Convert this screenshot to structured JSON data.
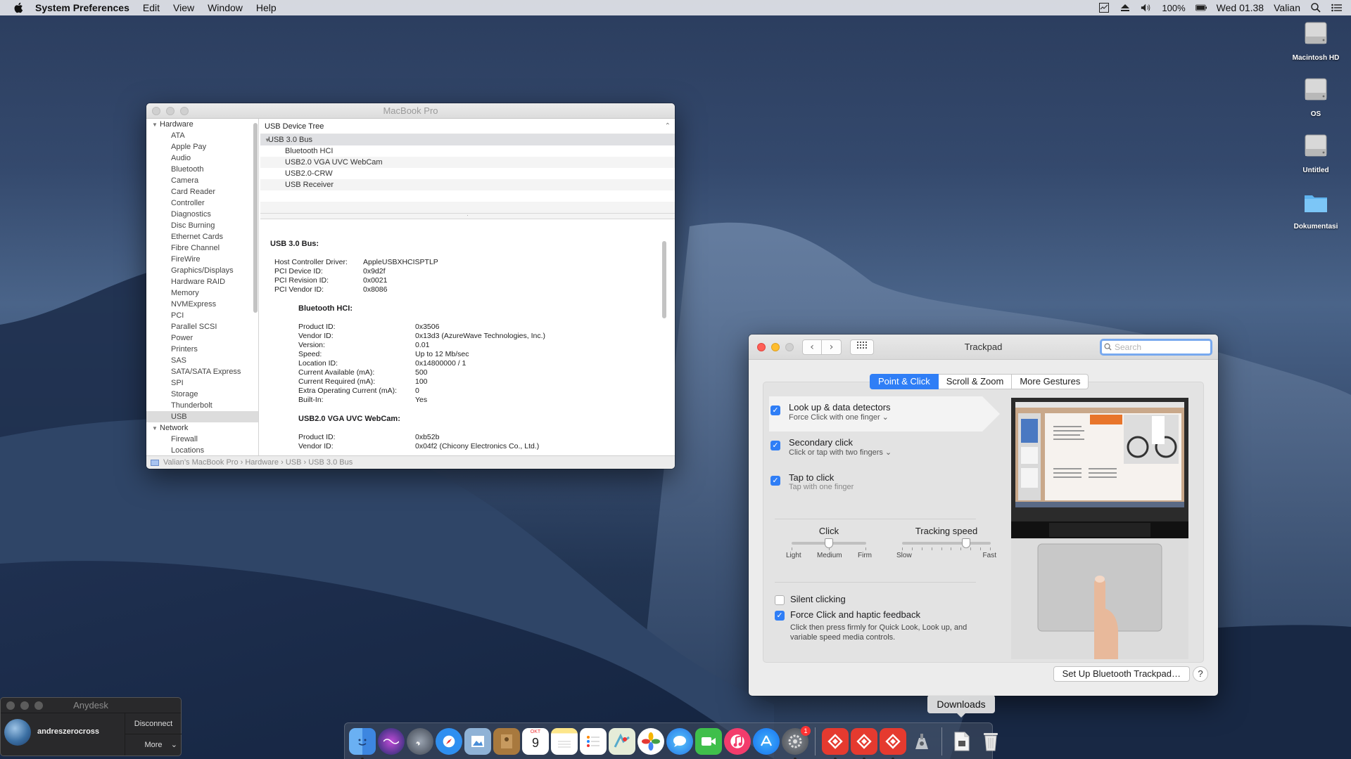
{
  "menubar": {
    "app_name": "System Preferences",
    "items": [
      "Edit",
      "View",
      "Window",
      "Help"
    ],
    "battery": "100%",
    "clock": "Wed 01.38",
    "user": "Valian"
  },
  "desktop": {
    "icons": [
      "Macintosh HD",
      "OS",
      "Untitled",
      "Dokumentasi"
    ]
  },
  "sysinfo": {
    "title": "MacBook Pro",
    "sidebar": {
      "hardware_label": "Hardware",
      "hardware_items": [
        "ATA",
        "Apple Pay",
        "Audio",
        "Bluetooth",
        "Camera",
        "Card Reader",
        "Controller",
        "Diagnostics",
        "Disc Burning",
        "Ethernet Cards",
        "Fibre Channel",
        "FireWire",
        "Graphics/Displays",
        "Hardware RAID",
        "Memory",
        "NVMExpress",
        "PCI",
        "Parallel SCSI",
        "Power",
        "Printers",
        "SAS",
        "SATA/SATA Express",
        "SPI",
        "Storage",
        "Thunderbolt",
        "USB"
      ],
      "network_label": "Network",
      "network_items": [
        "Firewall",
        "Locations"
      ]
    },
    "tree": {
      "header": "USB Device Tree",
      "bus": "USB 3.0 Bus",
      "devices": [
        "Bluetooth HCI",
        "USB2.0 VGA UVC WebCam",
        "USB2.0-CRW",
        "USB Receiver"
      ]
    },
    "detail": {
      "bus_title": "USB 3.0 Bus:",
      "bus_props": [
        {
          "k": "Host Controller Driver:",
          "v": "AppleUSBXHCISPTLP"
        },
        {
          "k": "PCI Device ID:",
          "v": "0x9d2f"
        },
        {
          "k": "PCI Revision ID:",
          "v": "0x0021"
        },
        {
          "k": "PCI Vendor ID:",
          "v": "0x8086"
        }
      ],
      "bt_title": "Bluetooth HCI:",
      "bt_props": [
        {
          "k": "Product ID:",
          "v": "0x3506"
        },
        {
          "k": "Vendor ID:",
          "v": "0x13d3  (AzureWave Technologies, Inc.)"
        },
        {
          "k": "Version:",
          "v": "0.01"
        },
        {
          "k": "Speed:",
          "v": "Up to 12 Mb/sec"
        },
        {
          "k": "Location ID:",
          "v": "0x14800000 / 1"
        },
        {
          "k": "Current Available (mA):",
          "v": "500"
        },
        {
          "k": "Current Required (mA):",
          "v": "100"
        },
        {
          "k": "Extra Operating Current (mA):",
          "v": "0"
        },
        {
          "k": "Built-In:",
          "v": "Yes"
        }
      ],
      "cam_title": "USB2.0 VGA UVC WebCam:",
      "cam_props": [
        {
          "k": "Product ID:",
          "v": "0xb52b"
        },
        {
          "k": "Vendor ID:",
          "v": "0x04f2  (Chicony Electronics Co., Ltd.)"
        }
      ]
    },
    "pathbar": "Valian’s MacBook Pro  ›  Hardware  ›  USB  ›  USB 3.0 Bus"
  },
  "trackpad": {
    "title": "Trackpad",
    "search_placeholder": "Search",
    "tabs": [
      "Point & Click",
      "Scroll & Zoom",
      "More Gestures"
    ],
    "options": [
      {
        "title": "Look up & data detectors",
        "sub": "Force Click with one finger ⌄"
      },
      {
        "title": "Secondary click",
        "sub": "Click or tap with two fingers ⌄"
      },
      {
        "title": "Tap to click",
        "sub": "Tap with one finger"
      }
    ],
    "click": {
      "label": "Click",
      "labels": [
        "Light",
        "Medium",
        "Firm"
      ],
      "value": "Medium"
    },
    "tracking": {
      "label": "Tracking speed",
      "labels": [
        "Slow",
        "Fast"
      ],
      "value_fraction": 0.75
    },
    "silent_clicking": "Silent clicking",
    "force_click": "Force Click and haptic feedback",
    "force_click_desc": "Click then press firmly for Quick Look, Look up, and variable speed media controls.",
    "bt_button": "Set Up Bluetooth Trackpad…",
    "help": "?"
  },
  "anydesk": {
    "title": "Anydesk",
    "user": "andreszerocross",
    "disconnect": "Disconnect",
    "more": "More"
  },
  "dock": {
    "tooltip": "Downloads",
    "calendar_month": "OKT",
    "calendar_day": "9",
    "prefs_badge": "1"
  }
}
